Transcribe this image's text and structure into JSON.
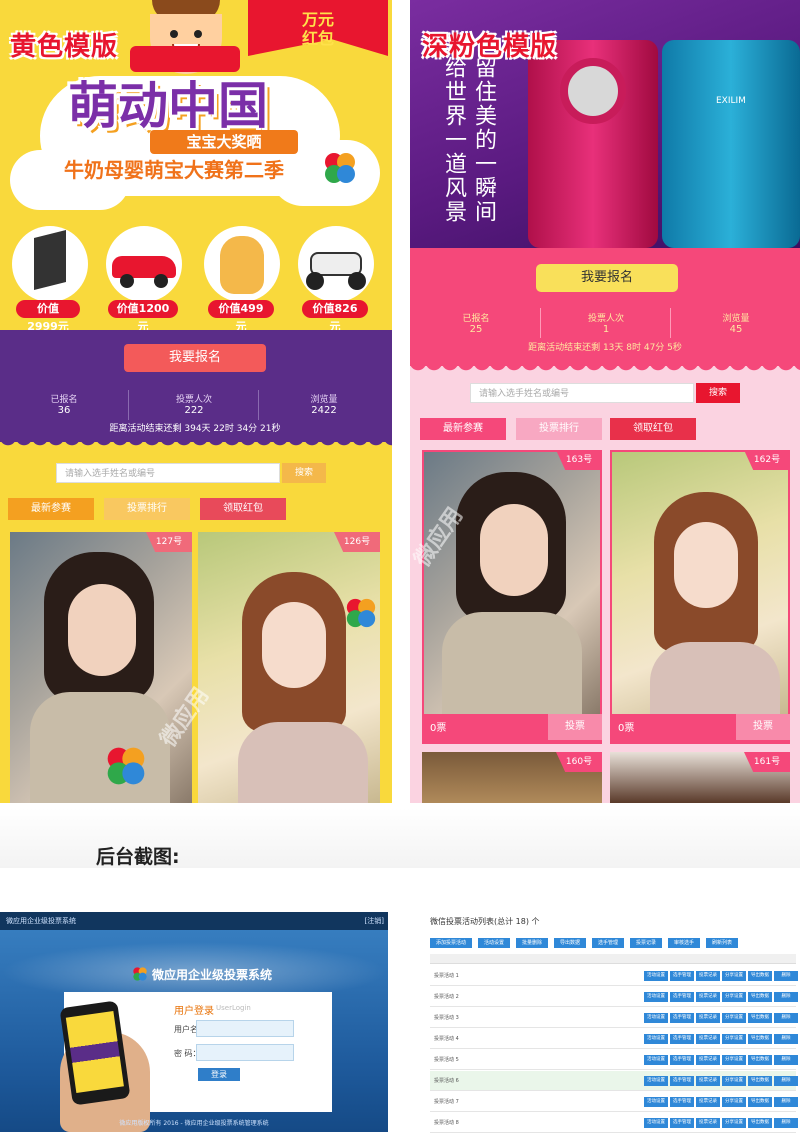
{
  "yellow_template": {
    "tag": "黄色模版",
    "red_packet": "万元\n红包",
    "title": "萌动中国",
    "prize_banner": "宝宝大奖晒",
    "season": "牛奶母婴萌宝大赛第二季",
    "prizes": [
      {
        "icon": "tv-icon",
        "price": "价值2999元"
      },
      {
        "icon": "toy-car-icon",
        "price": "价值1200元"
      },
      {
        "icon": "plush-cat-icon",
        "price": "价值499元"
      },
      {
        "icon": "motorbike-icon",
        "price": "价值826元"
      }
    ],
    "signup_label": "我要报名",
    "stats": [
      {
        "label": "已报名",
        "value": "36"
      },
      {
        "label": "投票人次",
        "value": "222"
      },
      {
        "label": "浏览量",
        "value": "2422"
      }
    ],
    "countdown": "距离活动结束还剩 394天 22时 34分 21秒",
    "search_placeholder": "请输入选手姓名或编号",
    "search_label": "搜索",
    "tabs": [
      "最新参赛",
      "投票排行",
      "领取红包"
    ],
    "entries": [
      {
        "number": "127号"
      },
      {
        "number": "126号"
      }
    ],
    "watermark": "微应用"
  },
  "pink_template": {
    "tag": "深粉色模版",
    "poem": [
      "留住美的一瞬间",
      "给世界一道风景"
    ],
    "signup_label": "我要报名",
    "stats": [
      {
        "label": "已报名",
        "value": "25"
      },
      {
        "label": "投票人次",
        "value": "1"
      },
      {
        "label": "浏览量",
        "value": "45"
      }
    ],
    "countdown": "距离活动结束还剩 13天 8时 47分 5秒",
    "search_placeholder": "请输入选手姓名或编号",
    "search_label": "搜索",
    "tabs": [
      "最新参赛",
      "投票排行",
      "领取红包"
    ],
    "entries": [
      {
        "number": "163号",
        "votes": "0票",
        "vote_label": "投票"
      },
      {
        "number": "162号",
        "votes": "0票",
        "vote_label": "投票"
      },
      {
        "number": "160号"
      },
      {
        "number": "161号"
      }
    ],
    "watermark": "微应用"
  },
  "section_heading": "后台截图:",
  "admin_login": {
    "topbar": "微应用企业级投票系统",
    "topbar_right": "[注销]",
    "system_title": "微应用企业级投票系统",
    "card_title": "用户登录",
    "card_subtitle": "UserLogin",
    "username_label": "用户名：",
    "password_label": "密 码：",
    "login_button": "登录",
    "footer": "微应用版权所有 2016 - 微应用企业级投票系统管理系统"
  },
  "admin_table": {
    "title": "微信投票活动列表(总计 18) 个",
    "toolbar": [
      "添加投票活动",
      "活动设置",
      "批量删除",
      "导出数据",
      "选手管理",
      "投票记录",
      "审核选手",
      "刷新列表"
    ],
    "row_actions": [
      "活动设置",
      "选手管理",
      "投票记录",
      "分享设置",
      "导出数据",
      "删除"
    ],
    "rows": [
      "投票活动 1",
      "投票活动 2",
      "投票活动 3",
      "投票活动 4",
      "投票活动 5",
      "投票活动 6",
      "投票活动 7",
      "投票活动 8"
    ]
  },
  "colors": {
    "yellow_bg": "#f9d93c",
    "purple_band": "#5a2d88",
    "pink_band": "#f5487a",
    "pink_bg": "#fbd3e1",
    "accent_red": "#e8162f"
  }
}
